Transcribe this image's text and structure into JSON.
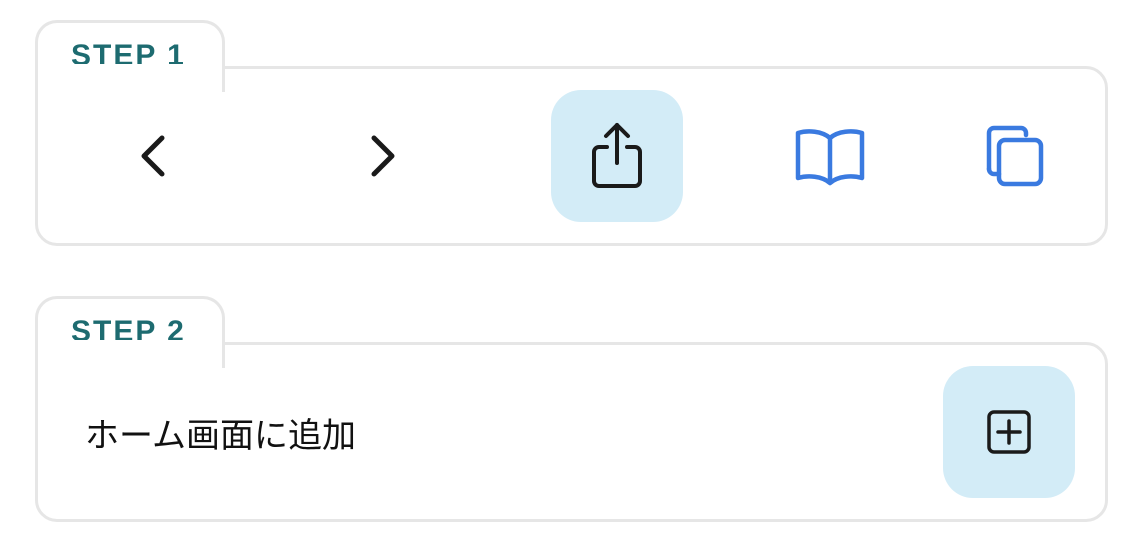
{
  "step1": {
    "label": "STEP 1",
    "toolbar": [
      {
        "icon": "chevron-left-icon"
      },
      {
        "icon": "chevron-right-icon"
      },
      {
        "icon": "share-icon",
        "highlighted": true
      },
      {
        "icon": "book-icon"
      },
      {
        "icon": "tabs-icon"
      }
    ]
  },
  "step2": {
    "label": "STEP 2",
    "action_label": "ホーム画面に追加",
    "action_icon": "add-square-icon"
  },
  "colors": {
    "step_label": "#1d6b70",
    "highlight_bg": "#d3ecf7",
    "accent_blue": "#3a7ae0",
    "border": "#e6e6e6",
    "icon_dark": "#1a1a1a"
  }
}
